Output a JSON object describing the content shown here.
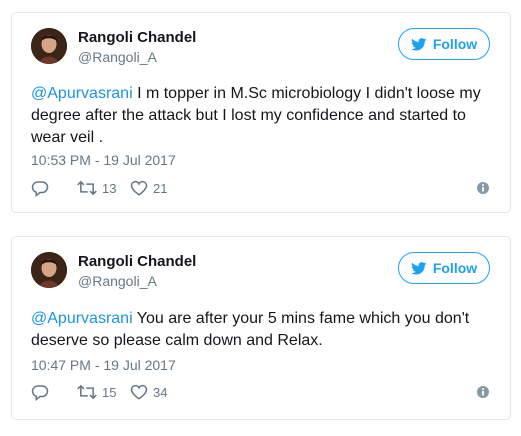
{
  "tweets": [
    {
      "author": {
        "name": "Rangoli Chandel",
        "handle": "@Rangoli_A"
      },
      "follow_label": "Follow",
      "mention": "@Apurvasrani",
      "body": " I m topper in M.Sc microbiology I didn't loose my degree after the attack but I lost my confidence and started to wear veil .",
      "timestamp": "10:53 PM - 19 Jul 2017",
      "retweets": "13",
      "likes": "21"
    },
    {
      "author": {
        "name": "Rangoli Chandel",
        "handle": "@Rangoli_A"
      },
      "follow_label": "Follow",
      "mention": "@Apurvasrani",
      "body": " You are after your 5 mins fame which you don't deserve so please calm down and Relax.",
      "timestamp": "10:47 PM - 19 Jul 2017",
      "retweets": "15",
      "likes": "34"
    }
  ],
  "colors": {
    "accent": "#1da1f2",
    "link": "#1b95e0",
    "text": "#14171a",
    "muted": "#657786",
    "border": "#e1e8ed"
  },
  "icons": [
    "twitter-bird-icon",
    "reply-icon",
    "retweet-icon",
    "heart-icon",
    "info-icon"
  ]
}
